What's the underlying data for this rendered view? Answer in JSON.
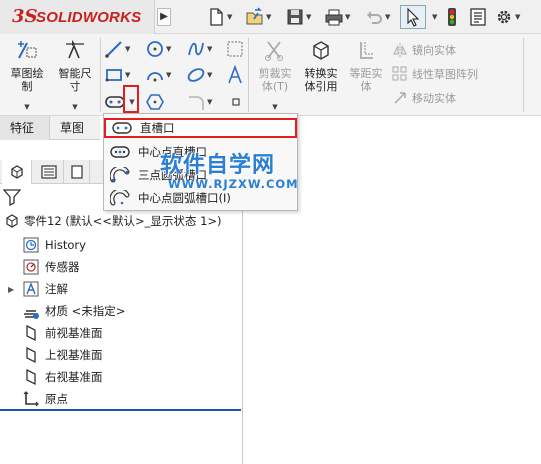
{
  "app": {
    "logo_mark": "3S",
    "logo_text": "SOLIDWORKS",
    "expand_glyph": "▶"
  },
  "quick_access": [
    {
      "icon": "new-document-icon"
    },
    {
      "icon": "open-folder-icon"
    },
    {
      "icon": "save-icon"
    },
    {
      "icon": "print-icon"
    },
    {
      "icon": "undo-icon"
    },
    {
      "icon": "select-pointer-icon"
    },
    {
      "icon": "traffic-light-icon"
    },
    {
      "icon": "file-properties-icon"
    },
    {
      "icon": "options-gear-icon"
    }
  ],
  "ribbon": {
    "sketch_button": "草图绘\n制",
    "smart_dim_button": "智能尺\n寸",
    "trim_button": "剪裁实\n体(T)",
    "convert_button": "转换实\n体引用",
    "offset_button": "等距实\n体",
    "mirror_entities": "镜向实体",
    "linear_pattern": "线性草图阵列",
    "move_entities": "移动实体"
  },
  "tabs": {
    "features": "特征",
    "sketch": "草图"
  },
  "slot_menu": {
    "items": [
      {
        "label": "直槽口"
      },
      {
        "label": "中心点直槽口"
      },
      {
        "label": "三点圆弧槽口"
      },
      {
        "label": "中心点圆弧槽口(I)"
      }
    ]
  },
  "tree": {
    "root": "零件12 (默认<<默认>_显示状态 1>)",
    "items": [
      {
        "label": "History",
        "icon": "history-icon"
      },
      {
        "label": "传感器",
        "icon": "sensor-icon"
      },
      {
        "label": "注解",
        "icon": "annotation-icon"
      },
      {
        "label": "材质 <未指定>",
        "icon": "material-icon"
      },
      {
        "label": "前视基准面",
        "icon": "plane-icon"
      },
      {
        "label": "上视基准面",
        "icon": "plane-icon"
      },
      {
        "label": "右视基准面",
        "icon": "plane-icon"
      },
      {
        "label": "原点",
        "icon": "origin-icon"
      }
    ]
  },
  "watermark": {
    "title": "软件自学网",
    "url": "WWW.RJZXW.COM"
  },
  "colors": {
    "brand_red": "#c8201d",
    "highlight_red": "#e02020",
    "watermark_blue": "#2a7fd4",
    "tree_divider_blue": "#1c56a8"
  }
}
